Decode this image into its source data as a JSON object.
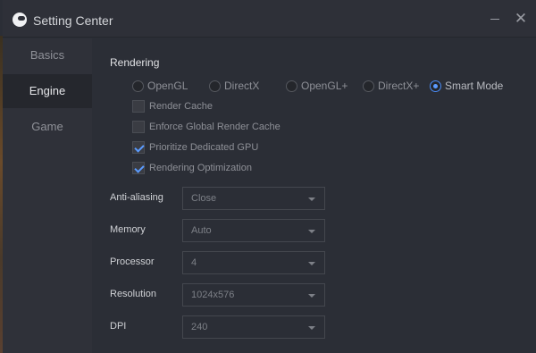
{
  "window": {
    "title": "Setting Center"
  },
  "sidebar": {
    "items": [
      {
        "label": "Basics"
      },
      {
        "label": "Engine"
      },
      {
        "label": "Game"
      }
    ]
  },
  "rendering": {
    "section_label": "Rendering",
    "modes": [
      {
        "label": "OpenGL",
        "selected": false
      },
      {
        "label": "DirectX",
        "selected": false
      },
      {
        "label": "OpenGL+",
        "selected": false
      },
      {
        "label": "DirectX+",
        "selected": false
      },
      {
        "label": "Smart Mode",
        "selected": true
      }
    ],
    "options": [
      {
        "label": "Render Cache",
        "checked": false
      },
      {
        "label": "Enforce Global Render Cache",
        "checked": false
      },
      {
        "label": "Prioritize Dedicated GPU",
        "checked": true
      },
      {
        "label": "Rendering Optimization",
        "checked": true
      }
    ]
  },
  "settings": [
    {
      "label": "Anti-aliasing",
      "value": "Close"
    },
    {
      "label": "Memory",
      "value": "Auto"
    },
    {
      "label": "Processor",
      "value": "4"
    },
    {
      "label": "Resolution",
      "value": "1024x576"
    },
    {
      "label": "DPI",
      "value": "240"
    }
  ],
  "colors": {
    "accent": "#5b9bff",
    "background": "#2b2e36"
  }
}
